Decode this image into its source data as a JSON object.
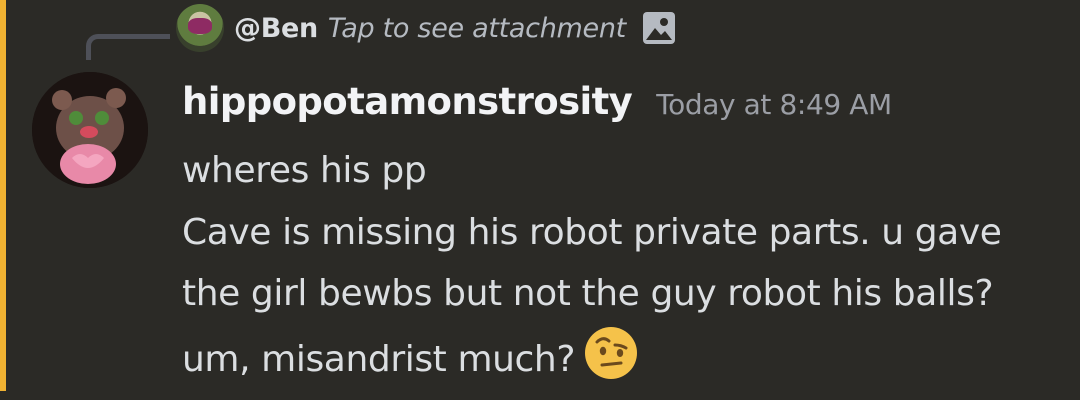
{
  "reply": {
    "username": "@Ben",
    "preview": "Tap to see attachment",
    "attachment_icon": "image-icon"
  },
  "message": {
    "author": "hippopotamonstrosity",
    "timestamp": "Today at 8:49 AM",
    "lines": [
      "wheres his pp",
      "Cave is missing his robot private parts. u gave the girl bewbs but not the guy robot his balls? um, misandrist much?"
    ],
    "emoji": "face-with-raised-eyebrow-emoji"
  },
  "colors": {
    "background": "#2b2a26",
    "mention_accent": "#f0b232",
    "author": "#f2f3f5",
    "text": "#dbdee1",
    "muted": "#9b9ea5"
  }
}
